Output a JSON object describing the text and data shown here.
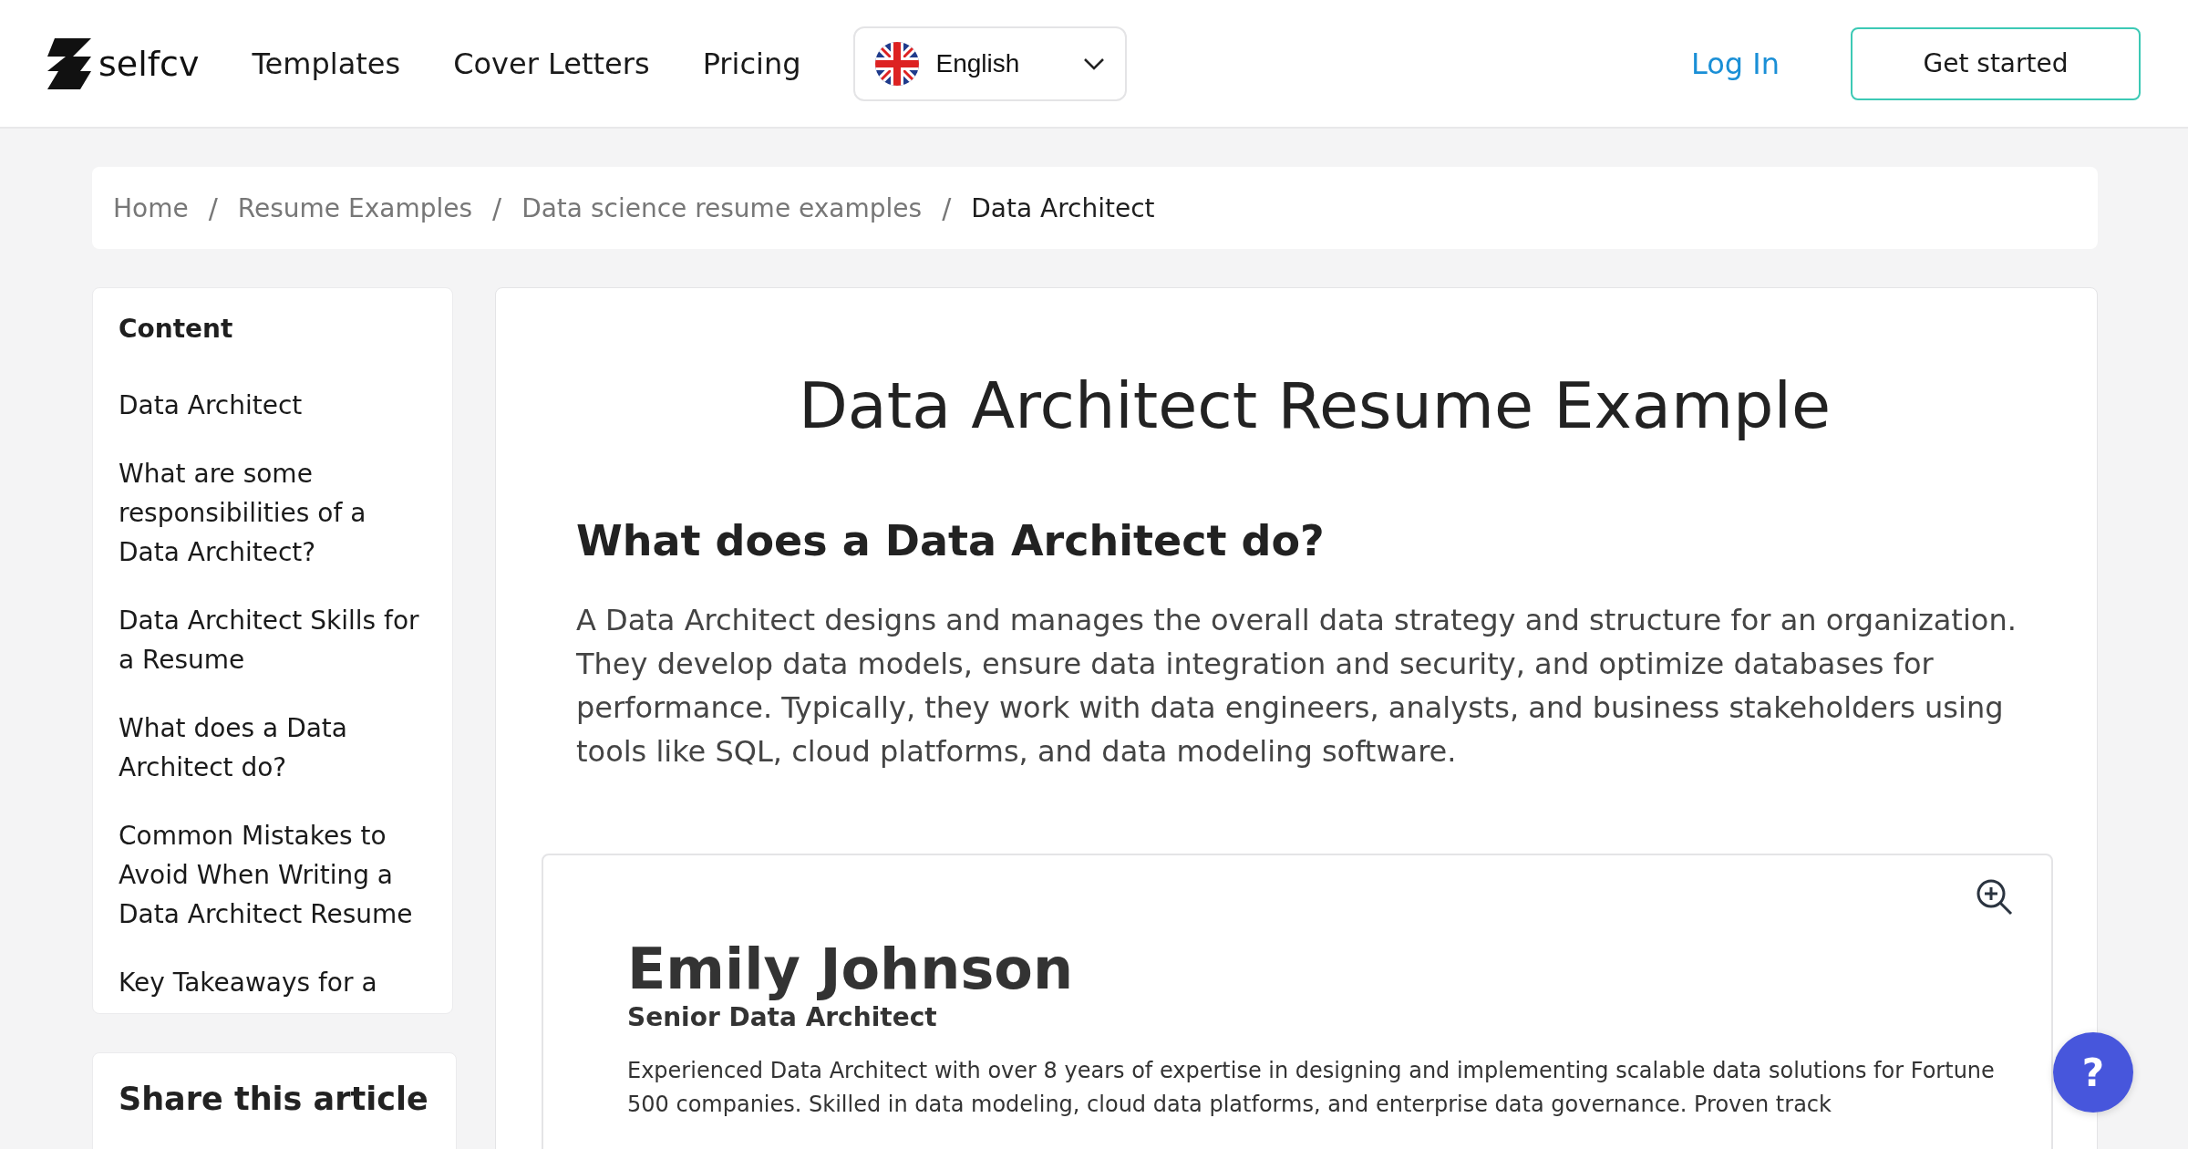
{
  "header": {
    "logo": "selfcv",
    "nav": [
      "Templates",
      "Cover Letters",
      "Pricing"
    ],
    "language": "English",
    "login": "Log In",
    "cta": "Get started"
  },
  "breadcrumb": [
    {
      "label": "Home",
      "current": false
    },
    {
      "label": "Resume Examples",
      "current": false
    },
    {
      "label": "Data science resume examples",
      "current": false
    },
    {
      "label": "Data Architect",
      "current": true
    }
  ],
  "breadcrumb_separator": "/",
  "toc": {
    "title": "Content",
    "items": [
      "Data Architect",
      "What are some responsibilities of a Data Architect?",
      "Data Architect Skills for a Resume",
      "What does a Data Architect do?",
      "Common Mistakes to Avoid When Writing a Data Architect Resume",
      "Key Takeaways for a"
    ]
  },
  "share": {
    "title": "Share this article"
  },
  "article": {
    "title": "Data Architect Resume Example",
    "heading": "What does a Data Architect do?",
    "paragraph": "A Data Architect designs and manages the overall data strategy and structure for an organization. They develop data models, ensure data integration and security, and optimize databases for performance. Typically, they work with data engineers, analysts, and business stakeholders using tools like SQL, cloud platforms, and data modeling software."
  },
  "resume": {
    "name": "Emily Johnson",
    "role": "Senior Data Architect",
    "summary": "Experienced Data Architect with over 8 years of expertise in designing and implementing scalable data solutions for Fortune 500 companies. Skilled in data modeling, cloud data platforms, and enterprise data governance. Proven track"
  },
  "help_button": "?"
}
